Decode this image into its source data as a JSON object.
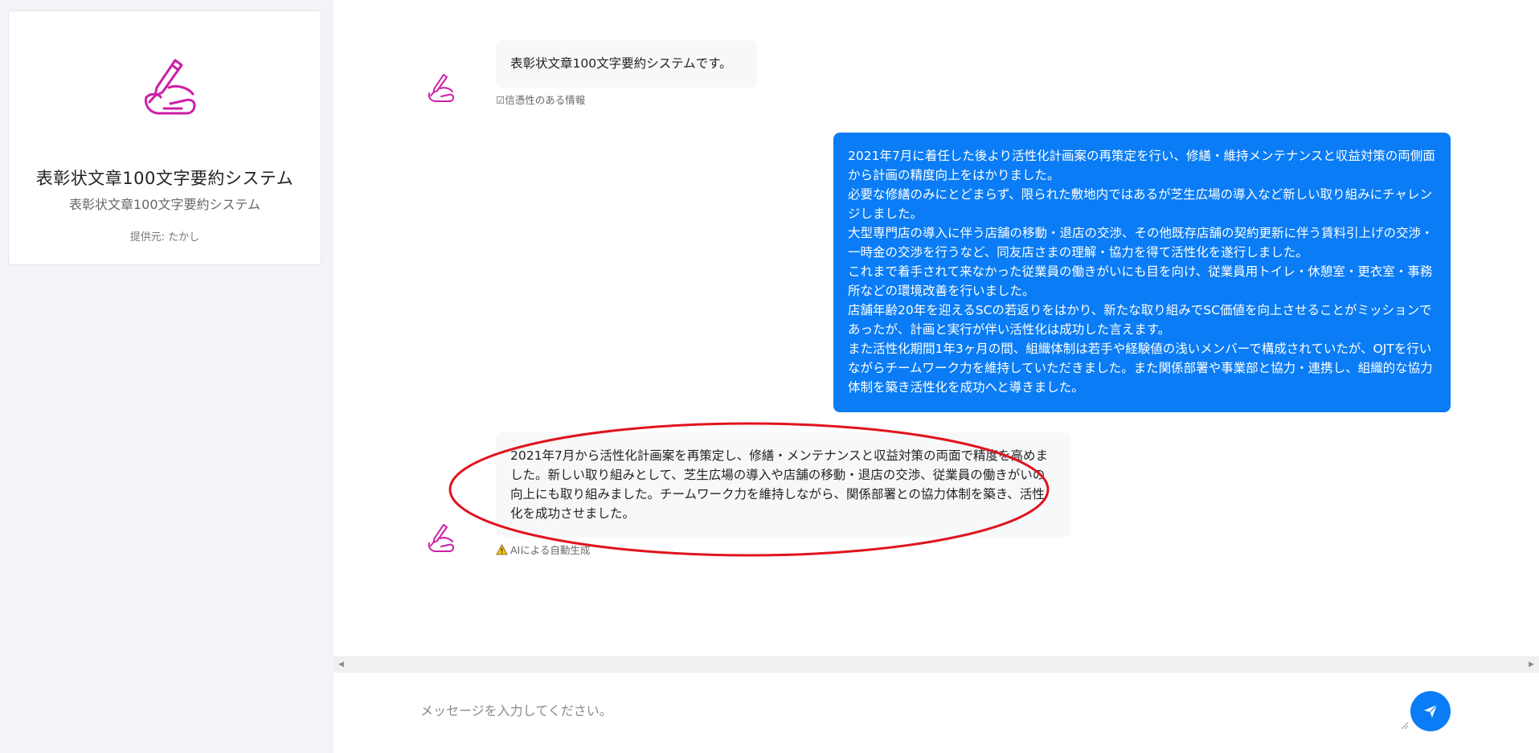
{
  "app": {
    "name": "表彰状文章100文字要約システム",
    "description": "表彰状文章100文字要約システム",
    "provider": "提供元: たかし",
    "logo_icon": "hand-writing-pen-icon",
    "accent_color": "#cc1fa8"
  },
  "messages": {
    "welcome": {
      "text": "表彰状文章100文字要約システムです。",
      "note": "☑信憑性のある情報"
    },
    "user": {
      "lines": [
        "2021年7月に着任した後より活性化計画案の再策定を行い、修繕・維持メンテナンスと収益対策の両側面から計画の精度向上をはかりました。",
        "必要な修繕のみにとどまらず、限られた敷地内ではあるが芝生広場の導入など新しい取り組みにチャレンジしました。",
        "大型専門店の導入に伴う店舗の移動・退店の交渉、その他既存店舗の契約更新に伴う賃料引上げの交渉・一時金の交渉を行うなど、同友店さまの理解・協力を得て活性化を遂行しました。",
        "これまで着手されて来なかった従業員の働きがいにも目を向け、従業員用トイレ・休憩室・更衣室・事務所などの環境改善を行いました。",
        "店舗年齢20年を迎えるSCの若返りをはかり、新たな取り組みでSC価値を向上させることがミッションであったが、計画と実行が伴い活性化は成功した言えます。",
        "また活性化期間1年3ヶ月の間、組織体制は若手や経験値の浅いメンバーで構成されていたが、OJTを行いながらチームワーク力を維持していただきました。また関係部署や事業部と協力・連携し、組織的な協力体制を築き活性化を成功へと導きました。"
      ],
      "color": "#0a7cf5"
    },
    "summary": {
      "text": "2021年7月から活性化計画案を再策定し、修繕・メンテナンスと収益対策の両面で精度を高めました。新しい取り組みとして、芝生広場の導入や店舗の移動・退店の交渉、従業員の働きがいの向上にも取り組みました。チームワーク力を維持しながら、関係部署との協力体制を築き、活性化を成功させました。",
      "note": "AIによる自動生成",
      "note_icon": "warning-icon",
      "annotation_color": "#e0141e"
    }
  },
  "composer": {
    "placeholder": "メッセージを入力してください。",
    "send_icon": "paper-plane-icon"
  }
}
